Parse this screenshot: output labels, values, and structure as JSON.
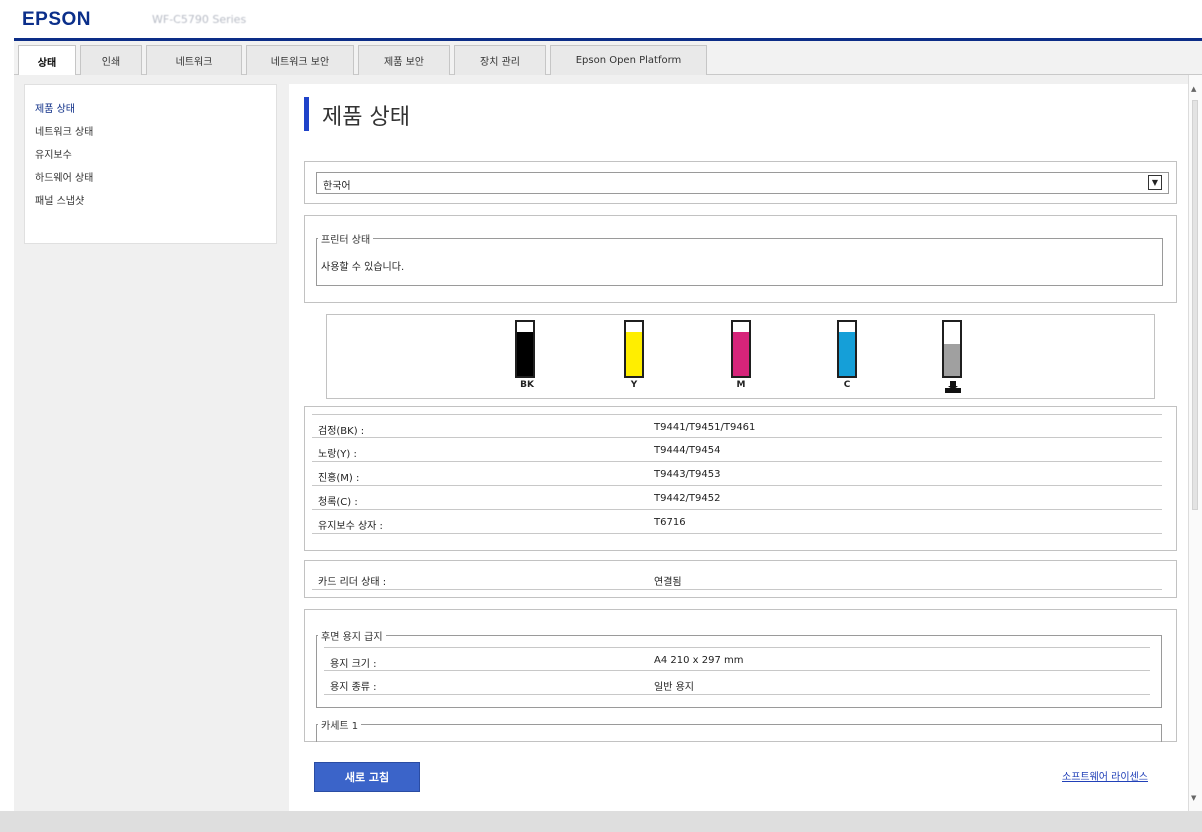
{
  "header": {
    "brand": "EPSON",
    "model": "WF-C5790 Series",
    "brand_color": "#0c2d87"
  },
  "tabs": [
    {
      "label": "상태",
      "active": true
    },
    {
      "label": "인쇄"
    },
    {
      "label": "네트워크"
    },
    {
      "label": "네트워크 보안"
    },
    {
      "label": "제품 보안"
    },
    {
      "label": "장치 관리"
    },
    {
      "label": "Epson Open Platform"
    }
  ],
  "sidebar": {
    "items": [
      {
        "label": "제품 상태",
        "active": true
      },
      {
        "label": "네트워크 상태"
      },
      {
        "label": "유지보수"
      },
      {
        "label": "하드웨어 상태"
      },
      {
        "label": "패널 스냅샷"
      }
    ]
  },
  "main": {
    "title": "제품 상태",
    "language": {
      "selected": "한국어"
    },
    "printer_status": {
      "legend": "프린터 상태",
      "message": "사용할 수 있습니다."
    },
    "inks": [
      {
        "label": "BK",
        "color": "#000000",
        "level": 0.82
      },
      {
        "label": "Y",
        "color": "#ffee00",
        "level": 0.82
      },
      {
        "label": "M",
        "color": "#d6247a",
        "level": 0.82
      },
      {
        "label": "C",
        "color": "#159fd8",
        "level": 0.82
      },
      {
        "label": "",
        "icon": "maintenance-box-icon",
        "color": "#a0a0a0",
        "level": 0.6
      }
    ],
    "cartridges": [
      {
        "key": "검정(BK) :",
        "value": "T9441/T9451/T9461"
      },
      {
        "key": "노랑(Y) :",
        "value": "T9444/T9454"
      },
      {
        "key": "진홍(M) :",
        "value": "T9443/T9453"
      },
      {
        "key": "청록(C) :",
        "value": "T9442/T9452"
      },
      {
        "key": "유지보수 상자 :",
        "value": "T6716"
      }
    ],
    "card_reader": {
      "key": "카드 리더 상태 :",
      "value": "연결됨"
    },
    "paper_rear": {
      "legend": "후면 용지 급지",
      "rows": [
        {
          "key": "용지 크기 :",
          "value": "A4 210 x 297 mm"
        },
        {
          "key": "용지 종류 :",
          "value": "일반 용지"
        }
      ]
    },
    "cassette": {
      "legend": "카세트 1"
    }
  },
  "footer": {
    "refresh_label": "새로 고침",
    "license_link": "소프트웨어 라이센스"
  }
}
